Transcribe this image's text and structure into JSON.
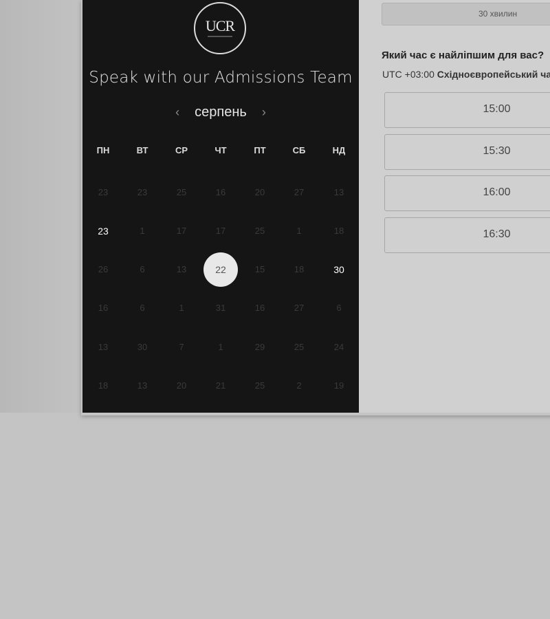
{
  "calendar": {
    "title": "Speak with our Admissions Team",
    "logo_text": "UCR",
    "month": "серпень",
    "prev_label": "‹",
    "next_label": "›",
    "weekdays": [
      "ПН",
      "ВТ",
      "СР",
      "ЧТ",
      "ПТ",
      "СБ",
      "НД"
    ],
    "weeks": [
      [
        {
          "t": "23",
          "s": "dim"
        },
        {
          "t": "23",
          "s": "dim"
        },
        {
          "t": "25",
          "s": "dim"
        },
        {
          "t": "16",
          "s": "dim"
        },
        {
          "t": "20",
          "s": "dim"
        },
        {
          "t": "27",
          "s": "dim"
        },
        {
          "t": "13",
          "s": "dim"
        }
      ],
      [
        {
          "t": "23",
          "s": "avail"
        },
        {
          "t": "1",
          "s": "dim"
        },
        {
          "t": "17",
          "s": "dim"
        },
        {
          "t": "17",
          "s": "dim"
        },
        {
          "t": "25",
          "s": "dim"
        },
        {
          "t": "1",
          "s": "dim"
        },
        {
          "t": "18",
          "s": "dim"
        }
      ],
      [
        {
          "t": "26",
          "s": "dim"
        },
        {
          "t": "6",
          "s": "dim"
        },
        {
          "t": "13",
          "s": "dim"
        },
        {
          "t": "22",
          "s": "sel"
        },
        {
          "t": "15",
          "s": "dim"
        },
        {
          "t": "18",
          "s": "dim"
        },
        {
          "t": "30",
          "s": "avail"
        }
      ],
      [
        {
          "t": "16",
          "s": "dim"
        },
        {
          "t": "6",
          "s": "dim"
        },
        {
          "t": "1",
          "s": "dim"
        },
        {
          "t": "31",
          "s": "dim"
        },
        {
          "t": "16",
          "s": "dim"
        },
        {
          "t": "27",
          "s": "dim"
        },
        {
          "t": "6",
          "s": "dim"
        }
      ],
      [
        {
          "t": "13",
          "s": "dim"
        },
        {
          "t": "30",
          "s": "dim"
        },
        {
          "t": "7",
          "s": "dim"
        },
        {
          "t": "1",
          "s": "dim"
        },
        {
          "t": "29",
          "s": "dim"
        },
        {
          "t": "25",
          "s": "dim"
        },
        {
          "t": "24",
          "s": "dim"
        }
      ],
      [
        {
          "t": "18",
          "s": "dim"
        },
        {
          "t": "13",
          "s": "dim"
        },
        {
          "t": "20",
          "s": "dim"
        },
        {
          "t": "21",
          "s": "dim"
        },
        {
          "t": "25",
          "s": "dim"
        },
        {
          "t": "2",
          "s": "dim"
        },
        {
          "t": "19",
          "s": "dim"
        }
      ]
    ]
  },
  "booking": {
    "duration": "30 хвилин",
    "question": "Який час є найліпшим для вас?",
    "timezone_offset": "UTC +03:00",
    "timezone_name": "Східноєвропейський час",
    "slots": [
      "15:00",
      "15:30",
      "16:00",
      "16:30"
    ]
  }
}
